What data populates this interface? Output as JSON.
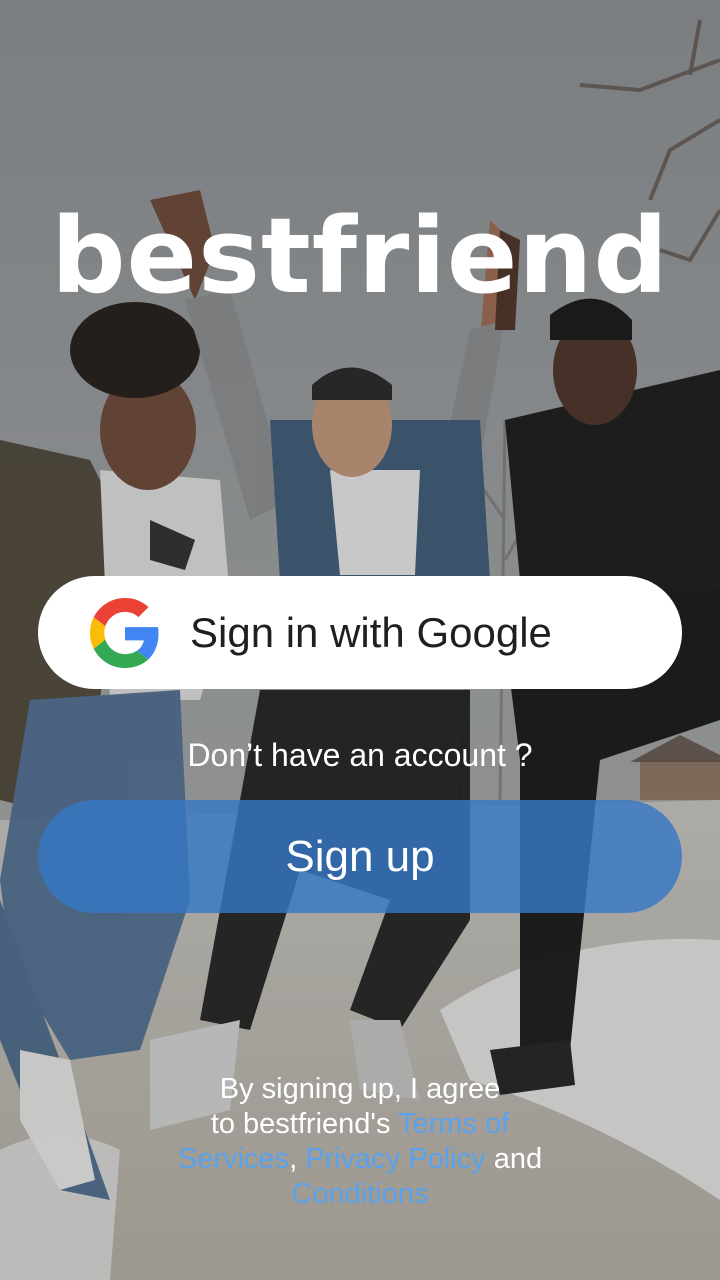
{
  "app": {
    "logo_text": "bestfriend"
  },
  "google_button": {
    "label": "Sign in with Google",
    "icon": "google-g-icon"
  },
  "account_prompt": "Don’t have an account ?",
  "signup_button": {
    "label": "Sign up"
  },
  "terms": {
    "line1": "By signing up, I agree",
    "line2_prefix": "to bestfriend's ",
    "terms_link_part1": "Terms of",
    "terms_link_part2": "Services",
    "comma": ",",
    "privacy_link": "Privacy Policy",
    "and_text": " and",
    "conditions_link": "Conditions"
  },
  "colors": {
    "link": "#5aa2ec",
    "signup_button": "#3678c4",
    "text": "#ffffff"
  }
}
